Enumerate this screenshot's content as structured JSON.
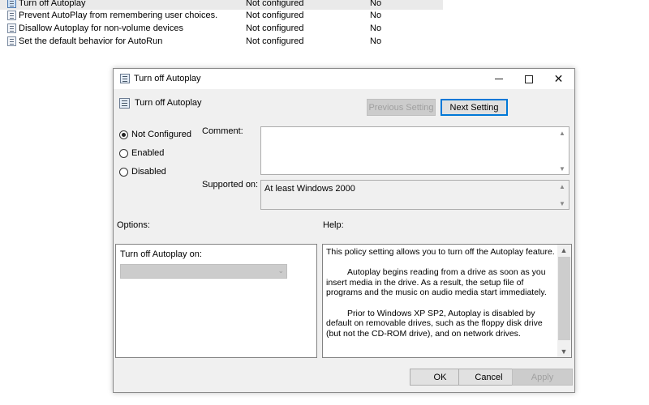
{
  "policies": [
    {
      "name": "Turn off Autoplay",
      "state": "Not configured",
      "comment": "No",
      "selected": true
    },
    {
      "name": "Prevent AutoPlay from remembering user choices.",
      "state": "Not configured",
      "comment": "No",
      "selected": false
    },
    {
      "name": "Disallow Autoplay for non-volume devices",
      "state": "Not configured",
      "comment": "No",
      "selected": false
    },
    {
      "name": "Set the default behavior for AutoRun",
      "state": "Not configured",
      "comment": "No",
      "selected": false
    }
  ],
  "dialog": {
    "window_title": "Turn off Autoplay",
    "window_controls": {
      "minimize": "minimize",
      "maximize": "maximize",
      "close": "✕"
    },
    "header_title": "Turn off Autoplay",
    "previous_setting": "Previous Setting",
    "next_setting": "Next Setting",
    "radios": [
      {
        "label": "Not Configured",
        "checked": true
      },
      {
        "label": "Enabled",
        "checked": false
      },
      {
        "label": "Disabled",
        "checked": false
      }
    ],
    "comment_label": "Comment:",
    "comment_value": "",
    "supported_label": "Supported on:",
    "supported_value": "At least Windows 2000",
    "options_label": "Options:",
    "help_label": "Help:",
    "options": {
      "dropdown_label": "Turn off Autoplay on:",
      "dropdown_value": ""
    },
    "help_paragraphs": [
      "This policy setting allows you to turn off the Autoplay feature.",
      "Autoplay begins reading from a drive as soon as you insert media in the drive. As a result, the setup file of programs and the music on audio media start immediately.",
      "Prior to Windows XP SP2, Autoplay is disabled by default on removable drives, such as the floppy disk drive (but not the CD-ROM drive), and on network drives."
    ],
    "buttons": {
      "ok": "OK",
      "cancel": "Cancel",
      "apply": "Apply"
    }
  },
  "icons": {
    "policy": "policy-setting-icon",
    "scroll_up": "▲",
    "scroll_down": "▼",
    "dropdown": "⌄"
  }
}
